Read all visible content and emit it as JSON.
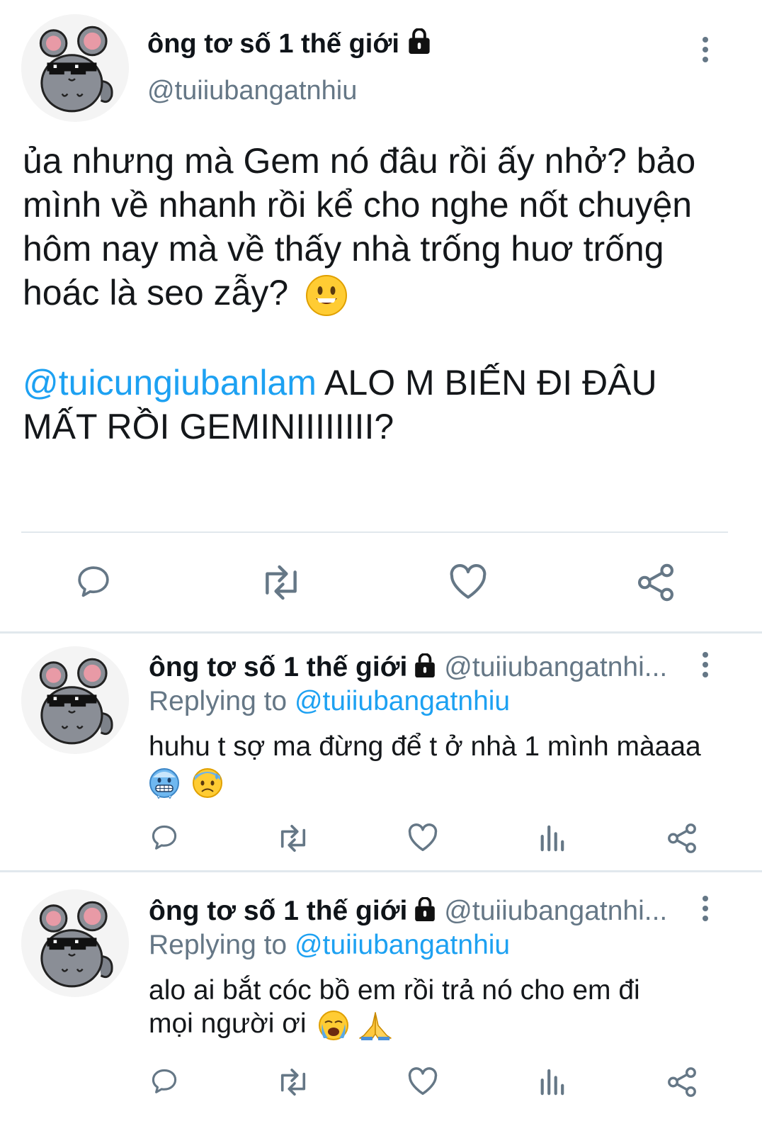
{
  "main_tweet": {
    "display_name": "ông tơ số 1 thế giới",
    "handle": "@tuiiubangatnhiu",
    "text_line1": "ủa nhưng mà Gem nó đâu rồi ấy nhở? bảo",
    "text_line2": "mình về nhanh rồi kể cho nghe nốt chuyện",
    "text_line3": "hôm nay mà về thấy nhà trống huơ trống",
    "text_line4": "hoác là seo zẫy?",
    "text_emoji": "smiley-emoji",
    "mention": "@tuicungiubanlam",
    "mention_text_line1": " ALO M BIẾN ĐI ĐÂU",
    "mention_text_line2": "MẤT RỒI GEMINIIIIIIII?"
  },
  "replies": [
    {
      "display_name": "ông tơ số 1 thế giới",
      "handle": "@tuiiubangatnhi...",
      "replying_label": "Replying to ",
      "replying_to": "@tuiiubangatnhiu",
      "text": "huhu t sợ ma đừng để t ở nhà 1 mình màaaa",
      "emojis": [
        "freezing-face-emoji",
        "anxious-sweat-face-emoji"
      ]
    },
    {
      "display_name": "ông tơ số 1 thế giới",
      "handle": "@tuiiubangatnhi...",
      "replying_label": "Replying to ",
      "replying_to": "@tuiiubangatnhiu",
      "text_line1": "alo ai bắt cóc bồ em rồi trả nó cho em đi",
      "text_line2": "mọi người ơi",
      "emojis": [
        "crying-face-emoji",
        "folded-hands-emoji"
      ]
    }
  ],
  "icons": {
    "reply": "reply-icon",
    "retweet": "retweet-icon",
    "like": "like-icon",
    "analytics": "analytics-icon",
    "share": "share-icon",
    "lock": "lock-icon",
    "more": "more-icon"
  },
  "colors": {
    "link": "#1da1f2",
    "secondary": "#657786",
    "text": "#14171a",
    "divider": "#e1e8ed"
  }
}
